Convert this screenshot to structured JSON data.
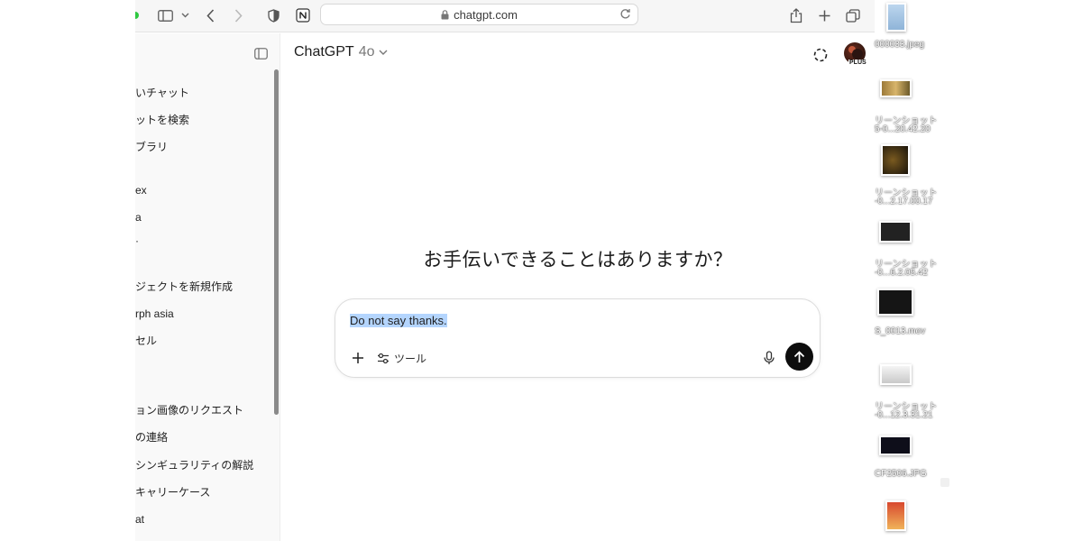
{
  "browser": {
    "url": "chatgpt.com",
    "icons": [
      "sidebar-toggle-icon",
      "chevron-down-icon",
      "back-icon",
      "forward-icon",
      "shield-icon",
      "notion-icon",
      "lock-icon",
      "reload-icon",
      "share-icon",
      "new-tab-icon",
      "tab-overview-icon"
    ]
  },
  "sidebar": {
    "items": [
      {
        "label": "いチャット"
      },
      {
        "label": "ットを検索"
      },
      {
        "label": "ブラリ"
      },
      {
        "label": "ex"
      },
      {
        "label": "a"
      },
      {
        "label": "·"
      },
      {
        "label": "ジェクトを新規作成"
      },
      {
        "label": "rph asia"
      },
      {
        "label": "セル"
      },
      {
        "label": "ョン画像のリクエスト"
      },
      {
        "label": "の連絡"
      },
      {
        "label": "シンギュラリティの解説"
      },
      {
        "label": "キャリーケース"
      },
      {
        "label": "at"
      }
    ]
  },
  "header": {
    "model_name": "ChatGPT",
    "model_version": "4o",
    "badge": "PLUS"
  },
  "main": {
    "greeting": "お手伝いできることはありますか？"
  },
  "composer": {
    "text": "Do not say thanks.",
    "tools_label": "ツール"
  },
  "desktop": {
    "labels": [
      "000033.jpeg",
      "リーンショット",
      "5-0...20.42.20",
      "リーンショット",
      "-0...2.17.00.17",
      "リーンショット",
      "-0...6.2.05.42",
      "S_0013.mov",
      "リーンショット",
      "-0...12.3.31.21",
      "CF2506.JPG"
    ]
  },
  "colors": {
    "accent": "#0d0d0d",
    "selection": "#b4d5fe",
    "sidebar_bg": "#f9f9f9"
  }
}
